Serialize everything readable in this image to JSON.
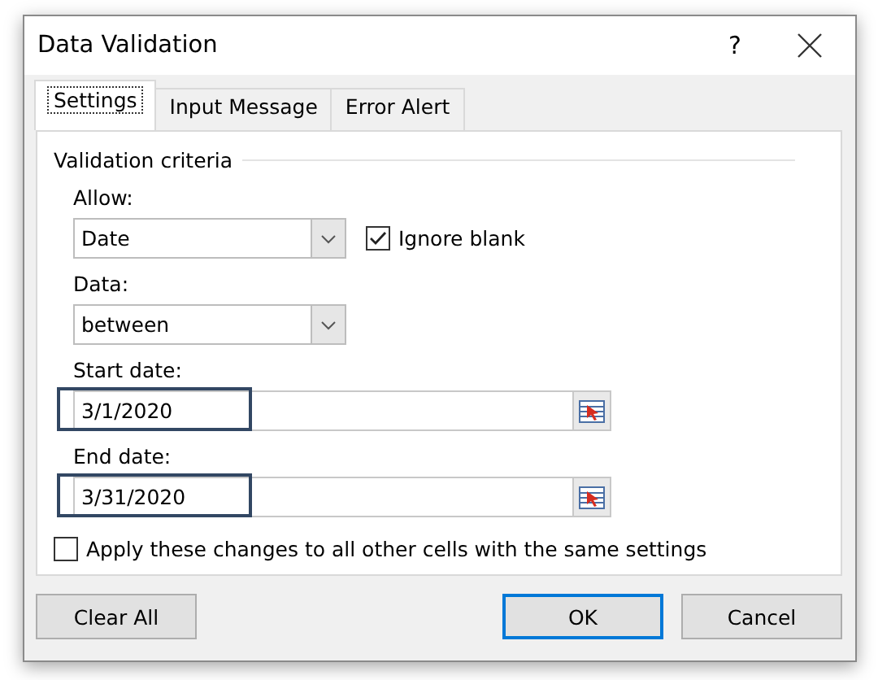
{
  "window": {
    "title": "Data Validation",
    "help": "?"
  },
  "tabs": [
    {
      "label": "Settings",
      "selected": true
    },
    {
      "label": "Input Message",
      "selected": false
    },
    {
      "label": "Error Alert",
      "selected": false
    }
  ],
  "section_title": "Validation criteria",
  "allow": {
    "label": "Allow:",
    "value": "Date"
  },
  "ignore_blank": {
    "label": "Ignore blank",
    "checked": true
  },
  "data": {
    "label": "Data:",
    "value": "between"
  },
  "ranges": [
    {
      "label": "Start date:",
      "value": "3/1/2020",
      "highlighted": true
    },
    {
      "label": "End date:",
      "value": "3/31/2020",
      "highlighted": true
    }
  ],
  "apply_all": {
    "label": "Apply these changes to all other cells with the same settings",
    "checked": false
  },
  "buttons": [
    {
      "label": "Clear All",
      "default": false
    },
    {
      "label": "OK",
      "default": true
    },
    {
      "label": "Cancel",
      "default": false
    }
  ]
}
